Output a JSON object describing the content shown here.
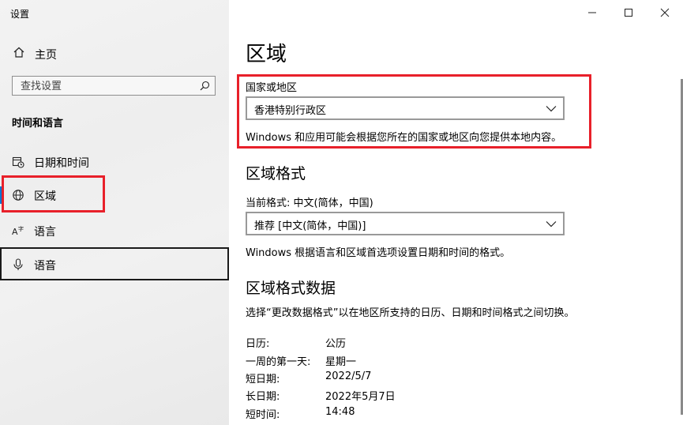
{
  "window": {
    "title": "设置"
  },
  "sidebar": {
    "home_label": "主页",
    "search_placeholder": "查找设置",
    "section_title": "时间和语言",
    "items": [
      {
        "label": "日期和时间",
        "icon": "calendar-clock-icon"
      },
      {
        "label": "区域",
        "icon": "globe-region-icon",
        "selected": true
      },
      {
        "label": "语言",
        "icon": "language-icon"
      },
      {
        "label": "语音",
        "icon": "microphone-icon"
      }
    ]
  },
  "main": {
    "title": "区域",
    "country": {
      "label": "国家或地区",
      "value": "香港特别行政区",
      "description": "Windows 和应用可能会根据您所在的国家或地区向您提供本地内容。"
    },
    "format": {
      "heading": "区域格式",
      "current_label": "当前格式: 中文(简体，中国)",
      "value": "推荐 [中文(简体，中国)]",
      "description": "Windows 根据语言和区域首选项设置日期和时间的格式。"
    },
    "format_data": {
      "heading": "区域格式数据",
      "description": "选择“更改数据格式”以在地区所支持的日历、日期和时间格式之间切换。",
      "rows": [
        {
          "key": "日历:",
          "value": "公历"
        },
        {
          "key": "一周的第一天:",
          "value": "星期一"
        },
        {
          "key": "短日期:",
          "value": "2022/5/7"
        },
        {
          "key": "长日期:",
          "value": "2022年5月7日"
        },
        {
          "key": "短时间:",
          "value": "14:48"
        }
      ]
    }
  },
  "colors": {
    "highlight": "#e8202a",
    "accent": "#0078d4"
  }
}
